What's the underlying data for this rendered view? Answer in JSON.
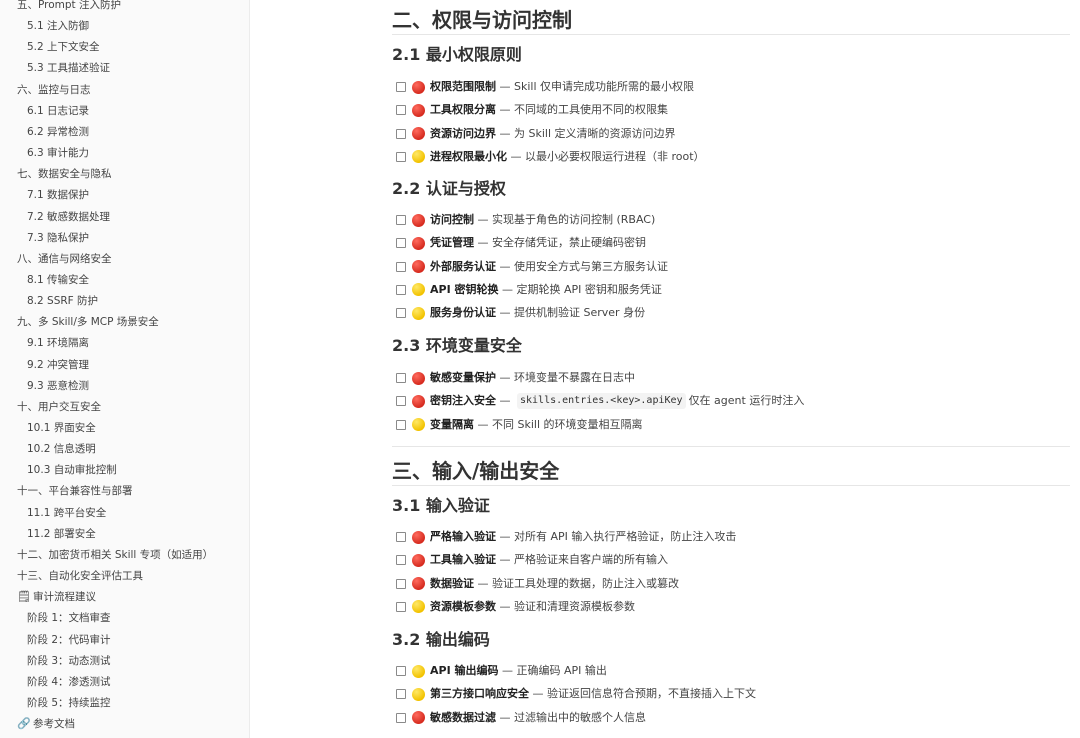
{
  "sidebar": {
    "items": [
      {
        "label": "五、Prompt 注入防护",
        "level": 1
      },
      {
        "label": "5.1 注入防御",
        "level": 2
      },
      {
        "label": "5.2 上下文安全",
        "level": 2
      },
      {
        "label": "5.3 工具描述验证",
        "level": 2
      },
      {
        "label": "六、监控与日志",
        "level": 1
      },
      {
        "label": "6.1 日志记录",
        "level": 2
      },
      {
        "label": "6.2 异常检测",
        "level": 2
      },
      {
        "label": "6.3 审计能力",
        "level": 2
      },
      {
        "label": "七、数据安全与隐私",
        "level": 1
      },
      {
        "label": "7.1 数据保护",
        "level": 2
      },
      {
        "label": "7.2 敏感数据处理",
        "level": 2
      },
      {
        "label": "7.3 隐私保护",
        "level": 2
      },
      {
        "label": "八、通信与网络安全",
        "level": 1
      },
      {
        "label": "8.1 传输安全",
        "level": 2
      },
      {
        "label": "8.2 SSRF 防护",
        "level": 2
      },
      {
        "label": "九、多 Skill/多 MCP 场景安全",
        "level": 1
      },
      {
        "label": "9.1 环境隔离",
        "level": 2
      },
      {
        "label": "9.2 冲突管理",
        "level": 2
      },
      {
        "label": "9.3 恶意检测",
        "level": 2
      },
      {
        "label": "十、用户交互安全",
        "level": 1
      },
      {
        "label": "10.1 界面安全",
        "level": 2
      },
      {
        "label": "10.2 信息透明",
        "level": 2
      },
      {
        "label": "10.3 自动审批控制",
        "level": 2
      },
      {
        "label": "十一、平台兼容性与部署",
        "level": 1
      },
      {
        "label": "11.1 跨平台安全",
        "level": 2
      },
      {
        "label": "11.2 部署安全",
        "level": 2
      },
      {
        "label": "十二、加密货币相关 Skill 专项（如适用）",
        "level": 1
      },
      {
        "label": "十三、自动化安全评估工具",
        "level": 1
      },
      {
        "label": "审计流程建议",
        "level": 1,
        "icon": "notepad-icon"
      },
      {
        "label": "阶段 1：文档审查",
        "level": 2
      },
      {
        "label": "阶段 2：代码审计",
        "level": 2
      },
      {
        "label": "阶段 3：动态测试",
        "level": 2
      },
      {
        "label": "阶段 4：渗透测试",
        "level": 2
      },
      {
        "label": "阶段 5：持续监控",
        "level": 2
      },
      {
        "label": "参考文档",
        "level": 1,
        "icon": "link-icon"
      }
    ]
  },
  "colors": {
    "red": "#d62b1f",
    "yellow": "#f2c200"
  },
  "content": {
    "h1_a": "二、权限与访问控制",
    "s21": {
      "title": "2.1 最小权限原则",
      "items": [
        {
          "priority": "red",
          "name": "权限范围限制",
          "sep": " — ",
          "desc": "Skill 仅申请完成功能所需的最小权限"
        },
        {
          "priority": "red",
          "name": "工具权限分离",
          "sep": " — ",
          "desc": "不同域的工具使用不同的权限集"
        },
        {
          "priority": "red",
          "name": "资源访问边界",
          "sep": " — ",
          "desc": "为 Skill 定义清晰的资源访问边界"
        },
        {
          "priority": "yellow",
          "name": "进程权限最小化",
          "sep": " — ",
          "desc": "以最小必要权限运行进程（非 root）"
        }
      ]
    },
    "s22": {
      "title": "2.2 认证与授权",
      "items": [
        {
          "priority": "red",
          "name": "访问控制",
          "sep": " — ",
          "desc": "实现基于角色的访问控制 (RBAC)"
        },
        {
          "priority": "red",
          "name": "凭证管理",
          "sep": " — ",
          "desc": "安全存储凭证，禁止硬编码密钥"
        },
        {
          "priority": "red",
          "name": "外部服务认证",
          "sep": " — ",
          "desc": "使用安全方式与第三方服务认证"
        },
        {
          "priority": "yellow",
          "name": "API 密钥轮换",
          "sep": " — ",
          "desc": "定期轮换 API 密钥和服务凭证"
        },
        {
          "priority": "yellow",
          "name": "服务身份认证",
          "sep": " — ",
          "desc": "提供机制验证 Server 身份"
        }
      ]
    },
    "s23": {
      "title": "2.3 环境变量安全",
      "items": [
        {
          "priority": "red",
          "name": "敏感变量保护",
          "sep": " — ",
          "desc": "环境变量不暴露在日志中"
        },
        {
          "priority": "red",
          "name": "密钥注入安全",
          "sep": " — ",
          "code": "skills.entries.<key>.apiKey",
          "desc": "仅在 agent 运行时注入"
        },
        {
          "priority": "yellow",
          "name": "变量隔离",
          "sep": " — ",
          "desc": "不同 Skill 的环境变量相互隔离"
        }
      ]
    },
    "h1_b": "三、输入/输出安全",
    "s31": {
      "title": "3.1 输入验证",
      "items": [
        {
          "priority": "red",
          "name": "严格输入验证",
          "sep": " — ",
          "desc": "对所有 API 输入执行严格验证，防止注入攻击"
        },
        {
          "priority": "red",
          "name": "工具输入验证",
          "sep": " — ",
          "desc": "严格验证来自客户端的所有输入"
        },
        {
          "priority": "red",
          "name": "数据验证",
          "sep": " — ",
          "desc": "验证工具处理的数据，防止注入或篡改"
        },
        {
          "priority": "yellow",
          "name": "资源模板参数",
          "sep": " — ",
          "desc": "验证和清理资源模板参数"
        }
      ]
    },
    "s32": {
      "title": "3.2 输出编码",
      "items": [
        {
          "priority": "yellow",
          "name": "API 输出编码",
          "sep": " — ",
          "desc": "正确编码 API 输出"
        },
        {
          "priority": "yellow",
          "name": "第三方接口响应安全",
          "sep": " — ",
          "desc": "验证返回信息符合预期，不直接插入上下文"
        },
        {
          "priority": "red",
          "name": "敏感数据过滤",
          "sep": " — ",
          "desc": "过滤输出中的敏感个人信息"
        }
      ]
    }
  }
}
